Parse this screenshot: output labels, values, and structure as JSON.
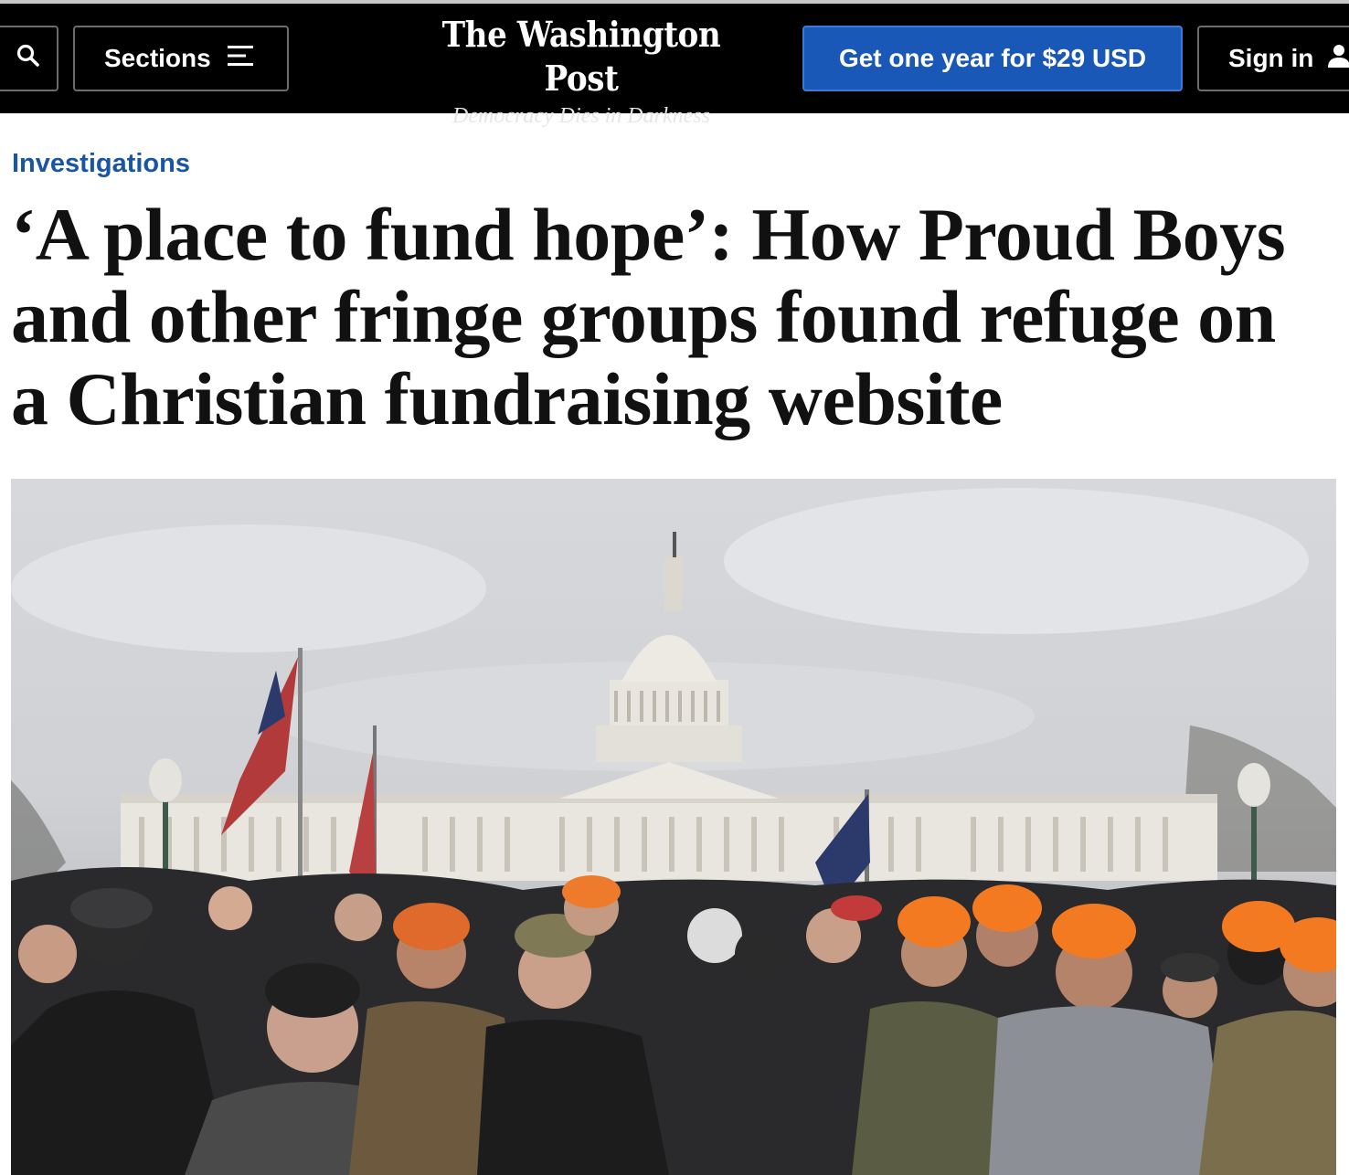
{
  "header": {
    "sections_label": "Sections",
    "logo_text": "The Washington Post",
    "tagline": "Democracy Dies in Darkness",
    "subscribe_label": "Get one year for $29 USD",
    "signin_label": "Sign in"
  },
  "article": {
    "kicker": "Investigations",
    "headline": "‘A place to fund hope’: How Proud Boys and other fringe groups found refuge on a Christian fundraising website"
  },
  "colors": {
    "header_bg": "#000000",
    "subscribe_bg": "#1a58b8",
    "kicker": "#1955a5",
    "headline": "#111111"
  },
  "icons": [
    "search-icon",
    "menu-icon",
    "person-icon"
  ]
}
